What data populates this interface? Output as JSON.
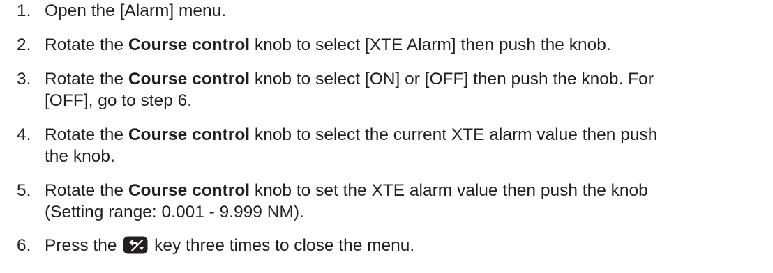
{
  "steps": [
    {
      "number": "1.",
      "parts": [
        "Open the [Alarm] menu."
      ]
    },
    {
      "number": "2.",
      "parts": [
        "Rotate the ",
        "Course control",
        " knob to select [XTE Alarm] then push the knob."
      ]
    },
    {
      "number": "3.",
      "parts": [
        "Rotate the ",
        "Course control",
        " knob to select [ON] or [OFF] then push the knob. For",
        "[OFF], go to step 6."
      ]
    },
    {
      "number": "4.",
      "parts": [
        "Rotate the ",
        "Course control",
        " knob to select the current XTE alarm value then push",
        "the knob."
      ]
    },
    {
      "number": "5.",
      "parts": [
        "Rotate the ",
        "Course control",
        " knob to set the XTE alarm value then push the knob",
        "(Setting range: 0.001 - 9.999 NM)."
      ]
    },
    {
      "number": "6.",
      "parts": [
        "Press the ",
        " key three times to close the menu."
      ]
    }
  ],
  "icons": {
    "key": "cancel-key-icon",
    "key_color": "#231f20"
  }
}
